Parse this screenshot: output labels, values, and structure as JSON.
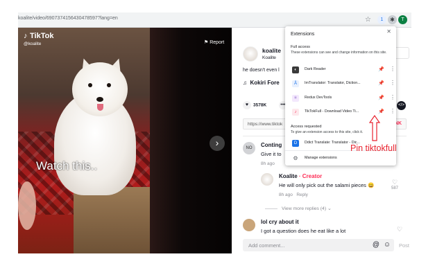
{
  "browser": {
    "url": "koalite/video/6907374156430478597?lang=en",
    "avatar_letter": "T",
    "ext_badge": "1"
  },
  "video": {
    "brand": "TikTok",
    "handle": "@koalite",
    "report_label": "Report",
    "overlay_text": "Watch this.."
  },
  "author": {
    "name": "koalite",
    "subtitle": "Koalite",
    "follow_label": "ng",
    "caption": "he doesn't even l",
    "music": "Kokiri Fore",
    "likes": "3578K",
    "link": "https://www.tiktok",
    "copy_label": "INK"
  },
  "comments": [
    {
      "avatar": "NO",
      "name": "Conting",
      "text": "Give it to",
      "meta": "8h ago"
    },
    {
      "name": "Koalite",
      "creator_label": " · Creator",
      "text": "He will only pick out the salami pieces 😄",
      "meta_age": "8h ago",
      "meta_reply": "Reply",
      "likes": "587"
    },
    {
      "name": "lol cry about it",
      "text": "I got a question does he eat like a lot"
    }
  ],
  "view_more": "View more replies (4)",
  "comment_input": {
    "placeholder": "Add comment...",
    "post_label": "Post"
  },
  "extensions_popup": {
    "title": "Extensions",
    "full_access_heading": "Full access",
    "full_access_desc": "These extensions can see and change information on this site.",
    "items": [
      {
        "name": "Dark Reader",
        "icon": "dark-reader-icon",
        "pinned": false
      },
      {
        "name": "ImTranslator: Translator, Diction...",
        "icon": "imtranslator-icon",
        "pinned": false
      },
      {
        "name": "Redux DevTools",
        "icon": "redux-icon",
        "pinned": false
      },
      {
        "name": "TikTokFull - Download Video Ti...",
        "icon": "tiktokfull-icon",
        "pinned": true
      }
    ],
    "requested_heading": "Access requested",
    "requested_desc": "To give an extension access to this site, click it.",
    "requested_items": [
      {
        "name": "Ddict Translate: Translator - Dic...",
        "icon": "ddict-icon"
      }
    ],
    "manage_label": "Manage extensions"
  },
  "annotation": {
    "text": "Pin tiktokfull",
    "color": "#e8222e"
  },
  "colors": {
    "accent": "#fe2c55",
    "pin_active": "#1a73e8"
  }
}
